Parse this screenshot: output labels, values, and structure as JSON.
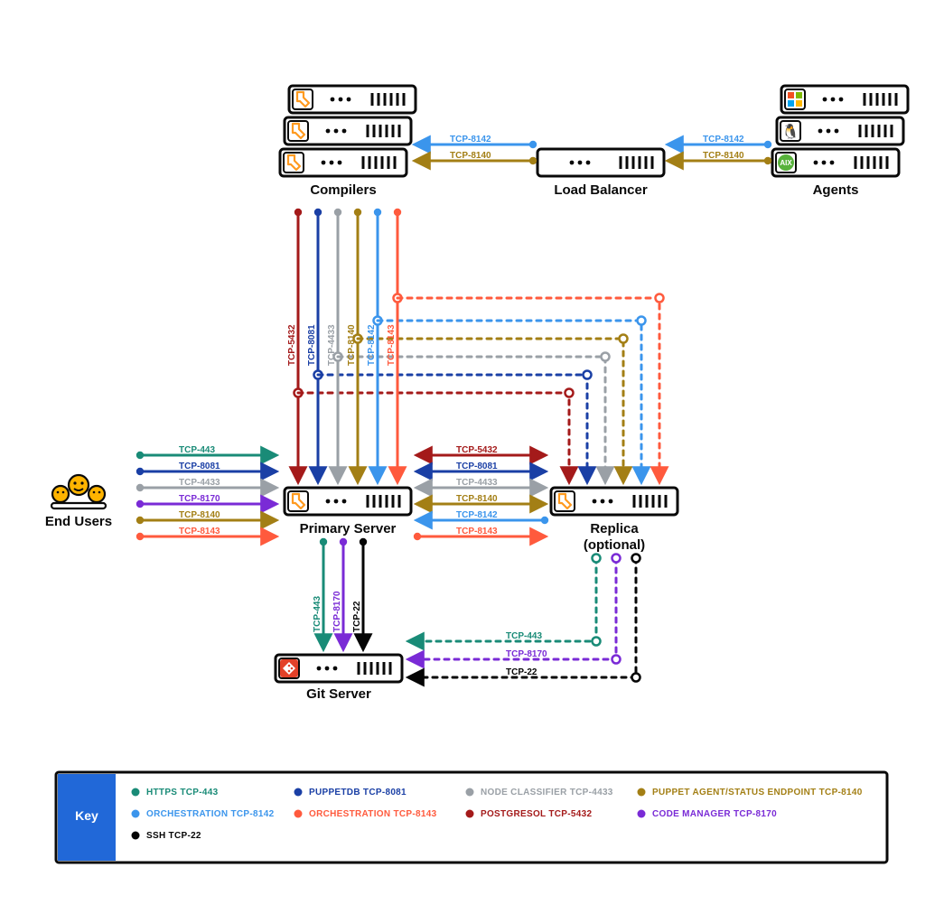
{
  "colors": {
    "https": "#198b77",
    "puppetdb": "#1a3fa5",
    "classifier": "#9aa0a6",
    "agent": "#a37f15",
    "orch8142": "#3b95ec",
    "orch8143": "#ff5a3d",
    "postgres": "#a41a1a",
    "codemgr": "#7a2bd6",
    "ssh": "#050505",
    "keyBlue": "#2168d8",
    "boxStroke": "#090909"
  },
  "nodes": {
    "compilers": "Compilers",
    "loadbalancer": "Load Balancer",
    "agents": "Agents",
    "endusers": "End Users",
    "primary": "Primary Server",
    "replica1": "Replica",
    "replica2": "(optional)",
    "git": "Git Server"
  },
  "ports": {
    "p443": "TCP-443",
    "p8081": "TCP-8081",
    "p4433": "TCP-4433",
    "p8140": "TCP-8140",
    "p8142": "TCP-8142",
    "p8143": "TCP-8143",
    "p5432": "TCP-5432",
    "p8170": "TCP-8170",
    "p22": "TCP-22"
  },
  "key": {
    "title": "Key",
    "items": [
      {
        "c": "https",
        "t": "HTTPS TCP-443"
      },
      {
        "c": "puppetdb",
        "t": "PUPPETDB TCP-8081"
      },
      {
        "c": "classifier",
        "t": "NODE CLASSIFIER TCP-4433"
      },
      {
        "c": "agent",
        "t": "PUPPET AGENT/STATUS ENDPOINT TCP-8140"
      },
      {
        "c": "orch8142",
        "t": "ORCHESTRATION TCP-8142"
      },
      {
        "c": "orch8143",
        "t": "ORCHESTRATION TCP-8143"
      },
      {
        "c": "postgres",
        "t": "POSTGRESOL TCP-5432"
      },
      {
        "c": "codemgr",
        "t": "CODE MANAGER TCP-8170"
      },
      {
        "c": "ssh",
        "t": "SSH TCP-22"
      }
    ]
  }
}
